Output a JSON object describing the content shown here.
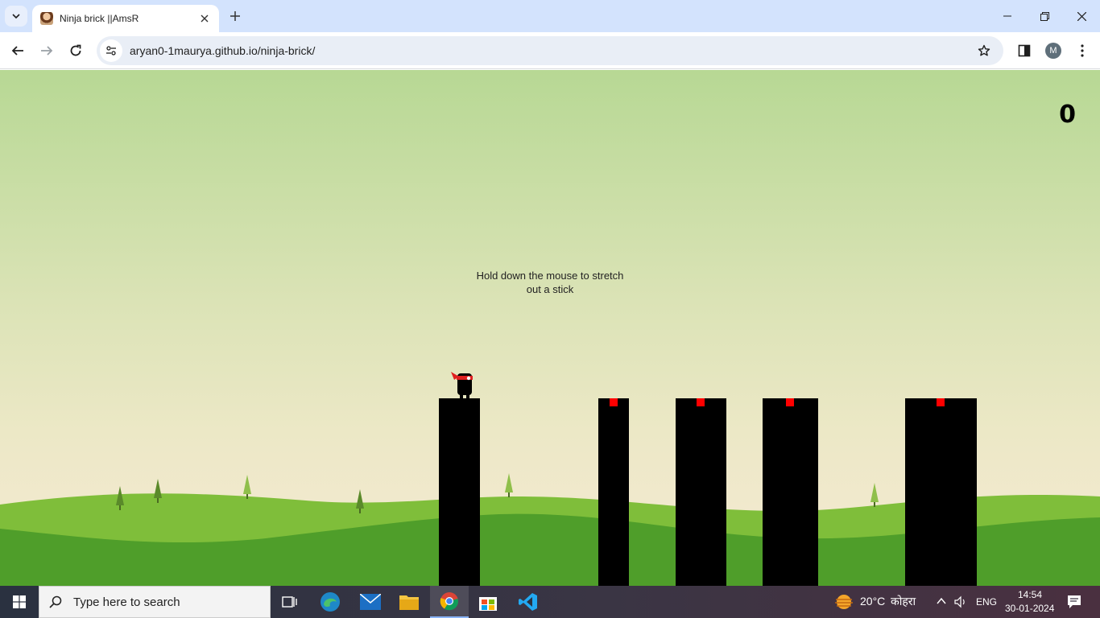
{
  "browser": {
    "tab_title": "Ninja brick ||AmsR",
    "url": "aryan0-1maurya.github.io/ninja-brick/",
    "profile_initial": "M"
  },
  "game": {
    "score": "0",
    "introduction": "Hold down the mouse to stretch out a stick",
    "platforms": 5
  },
  "taskbar": {
    "search_placeholder": "Type here to search",
    "weather_temp": "20°C",
    "weather_desc": "कोहरा",
    "language": "ENG",
    "time": "14:54",
    "date": "30-01-2024"
  },
  "colors": {
    "sky_top": "#b7d894",
    "sky_bottom": "#f6ead4",
    "hill_light": "#7fbe3a",
    "hill_dark": "#4f9e2a",
    "platform": "#000000",
    "perfect_target": "#ff0000",
    "tabstrip": "#d3e3fd"
  }
}
